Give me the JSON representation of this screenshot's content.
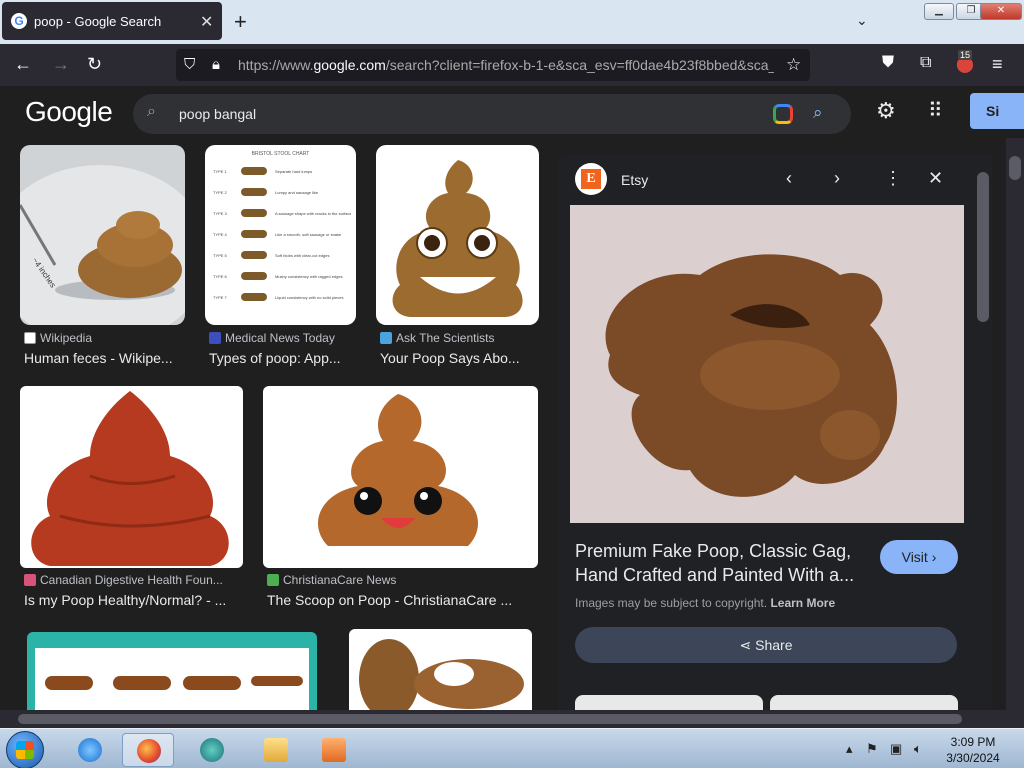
{
  "browser": {
    "tab_title": "poop - Google Search",
    "tab_icon": "G",
    "new_tab": "+",
    "url_prefix": "https://www.",
    "url_host": "google.com",
    "url_rest": "/search?client=firefox-b-1-e&sca_esv=ff0dae4b23f8bbed&sca_u",
    "extension_badge": "15"
  },
  "google": {
    "logo": "Google",
    "search_value": "poop bangal",
    "signin_label": "Si"
  },
  "results": [
    {
      "source": "Wikipedia",
      "title": "Human feces - Wikipe...",
      "fav_color": "#ffffff"
    },
    {
      "source": "Medical News Today",
      "title": "Types of poop: App...",
      "fav_color": "#3b4fbf"
    },
    {
      "source": "Ask The Scientists",
      "title": "Your Poop Says Abo...",
      "fav_color": "#4aa3df"
    },
    {
      "source": "Canadian Digestive Health Foun...",
      "title": "Is my Poop Healthy/Normal? - ...",
      "fav_color": "#d6547a"
    },
    {
      "source": "ChristianaCare News",
      "title": "The Scoop on Poop - ChristianaCare ...",
      "fav_color": "#4caf50"
    }
  ],
  "thumb_labels": {
    "chart_title": "BRISTOL STOOL CHART",
    "ruler": "~4 inches",
    "types": [
      "TYPE 1",
      "TYPE 2",
      "TYPE 3",
      "TYPE 4",
      "TYPE 5",
      "TYPE 6",
      "TYPE 7"
    ],
    "descriptions": [
      "Separate hard lumps",
      "Lumpy and sausage like",
      "A sausage shape with cracks in the surface",
      "Like a smooth, soft sausage or snake",
      "Soft blobs with clear-cut edges",
      "Mushy consistency with ragged edges",
      "Liquid consistency with no solid pieces"
    ]
  },
  "panel": {
    "site": "Etsy",
    "logo_letter": "E",
    "title": "Premium Fake Poop, Classic Gag, Hand Crafted and Painted With a...",
    "visit_label": "Visit",
    "copyright": "Images may be subject to copyright.",
    "learn_more": "Learn More",
    "share_label": "Share"
  },
  "taskbar": {
    "time": "3:09 PM",
    "date": "3/30/2024"
  },
  "colors": {
    "accent": "#8ab4f8",
    "background": "#1f1f1f",
    "etsy": "#f1641e"
  }
}
